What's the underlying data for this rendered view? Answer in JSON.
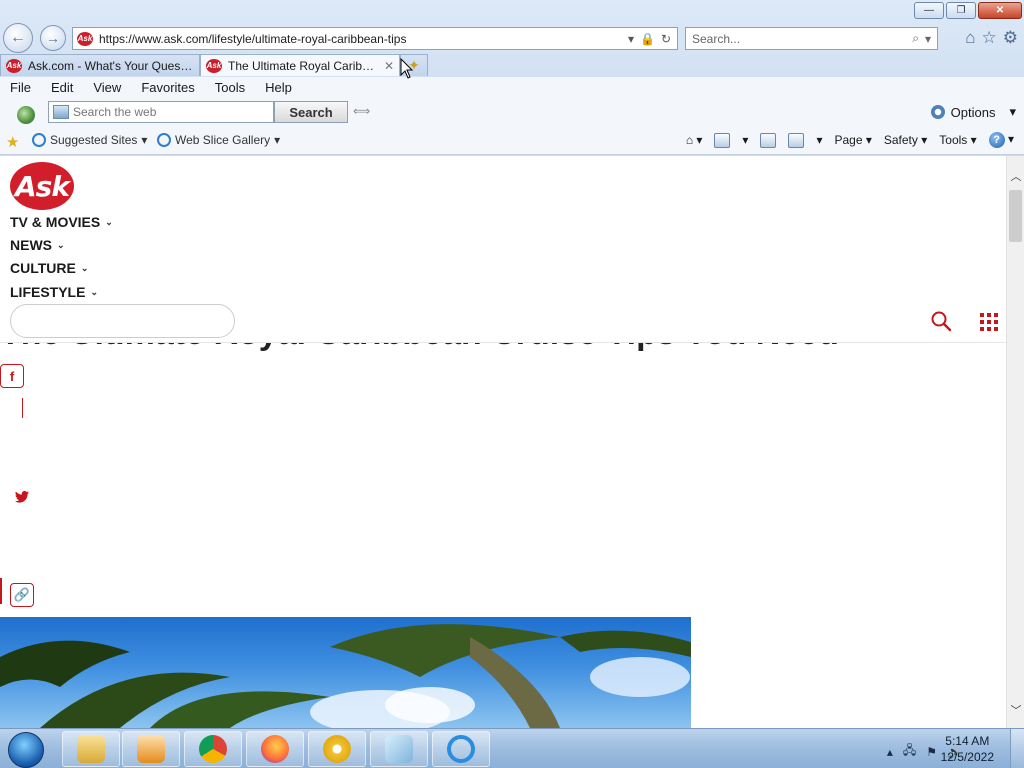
{
  "window": {
    "minimize_label": "—",
    "restore_label": "❐",
    "close_label": "✕"
  },
  "address_bar": {
    "url": "https://www.ask.com/lifestyle/ultimate-royal-caribbean-tips",
    "favicon_text": "Ask"
  },
  "search_box": {
    "placeholder": "Search..."
  },
  "tabs": [
    {
      "label": "Ask.com - What's Your Questi...",
      "favicon_text": "Ask"
    },
    {
      "label": "The Ultimate Royal Caribbe...",
      "favicon_text": "Ask",
      "close": "✕"
    }
  ],
  "menubar": {
    "items": [
      "File",
      "Edit",
      "View",
      "Favorites",
      "Tools",
      "Help"
    ]
  },
  "web_toolbar": {
    "search_placeholder": "Search the web",
    "search_button": "Search",
    "options_label": "Options"
  },
  "favorites_bar": {
    "suggested_sites": "Suggested Sites",
    "web_slice_gallery": "Web Slice Gallery"
  },
  "command_bar": {
    "page_label": "Page",
    "safety_label": "Safety",
    "tools_label": "Tools",
    "help_label": "?"
  },
  "site": {
    "logo_text": "Ask",
    "nav": [
      {
        "label": "TV & MOVIES"
      },
      {
        "label": "NEWS"
      },
      {
        "label": "CULTURE"
      },
      {
        "label": "LIFESTYLE"
      }
    ],
    "article_title": "The Ultimate Royal Caribbean Cruise Tips You Need",
    "share": {
      "facebook": "f",
      "twitter": "🐦",
      "link": "🔗"
    }
  },
  "taskbar": {
    "time": "5:14 AM",
    "date": "12/5/2022"
  },
  "colors": {
    "ask_red": "#c4161c",
    "chrome_blue": "#cfdff2"
  }
}
